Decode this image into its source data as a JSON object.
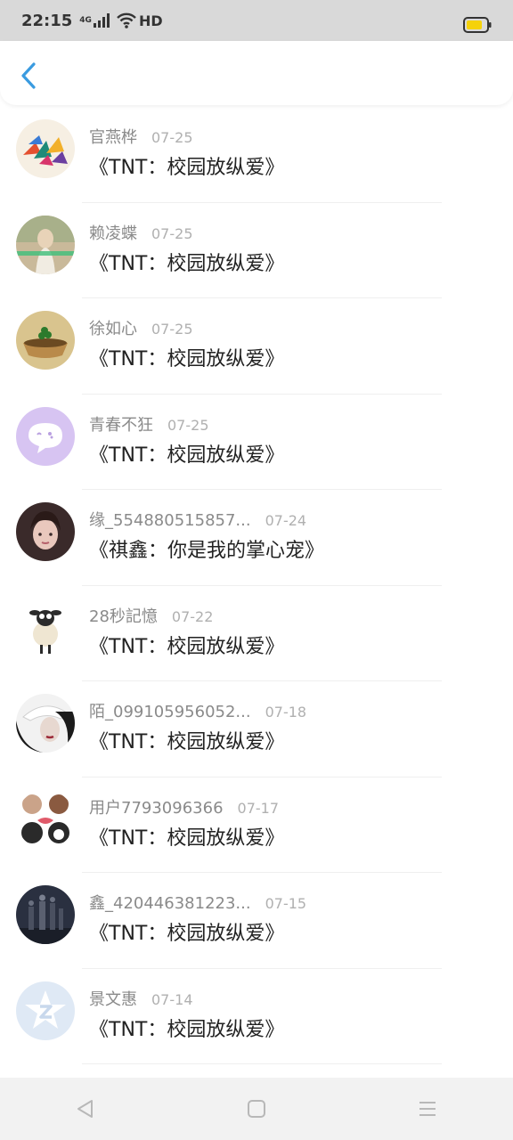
{
  "status_bar": {
    "time": "22:15",
    "network": "4G",
    "hd": "HD",
    "battery_color": "#f5d20a"
  },
  "header": {
    "back_icon": "chevron-left-icon",
    "accent": "#3a9be0"
  },
  "items": [
    {
      "name": "官燕桦",
      "date": "07-25",
      "title": "《TNT：校园放纵爱》",
      "avatar": "paper-cranes"
    },
    {
      "name": "赖凌蝶",
      "date": "07-25",
      "title": "《TNT：校园放纵爱》",
      "avatar": "girl-photo"
    },
    {
      "name": "徐如心",
      "date": "07-25",
      "title": "《TNT：校园放纵爱》",
      "avatar": "clover-cup"
    },
    {
      "name": "青春不狂",
      "date": "07-25",
      "title": "《TNT：校园放纵爱》",
      "avatar": "chat-bubble-purple"
    },
    {
      "name": "缘_554880515857...",
      "date": "07-24",
      "title": "《祺鑫：你是我的掌心宠》",
      "avatar": "girl-portrait"
    },
    {
      "name": "28秒記憶",
      "date": "07-22",
      "title": "《TNT：校园放纵爱》",
      "avatar": "sheep-cartoon"
    },
    {
      "name": "陌_099105956052...",
      "date": "07-18",
      "title": "《TNT：校园放纵爱》",
      "avatar": "hat-girl"
    },
    {
      "name": "用户7793096366",
      "date": "07-17",
      "title": "《TNT：校园放纵爱》",
      "avatar": "puppies"
    },
    {
      "name": "鑫_420446381223...",
      "date": "07-15",
      "title": "《TNT：校园放纵爱》",
      "avatar": "stage-group"
    },
    {
      "name": "景文惠",
      "date": "07-14",
      "title": "《TNT：校园放纵爱》",
      "avatar": "qq-default"
    }
  ],
  "nav": [
    {
      "icon": "back-triangle-icon"
    },
    {
      "icon": "home-square-icon"
    },
    {
      "icon": "menu-lines-icon"
    }
  ]
}
